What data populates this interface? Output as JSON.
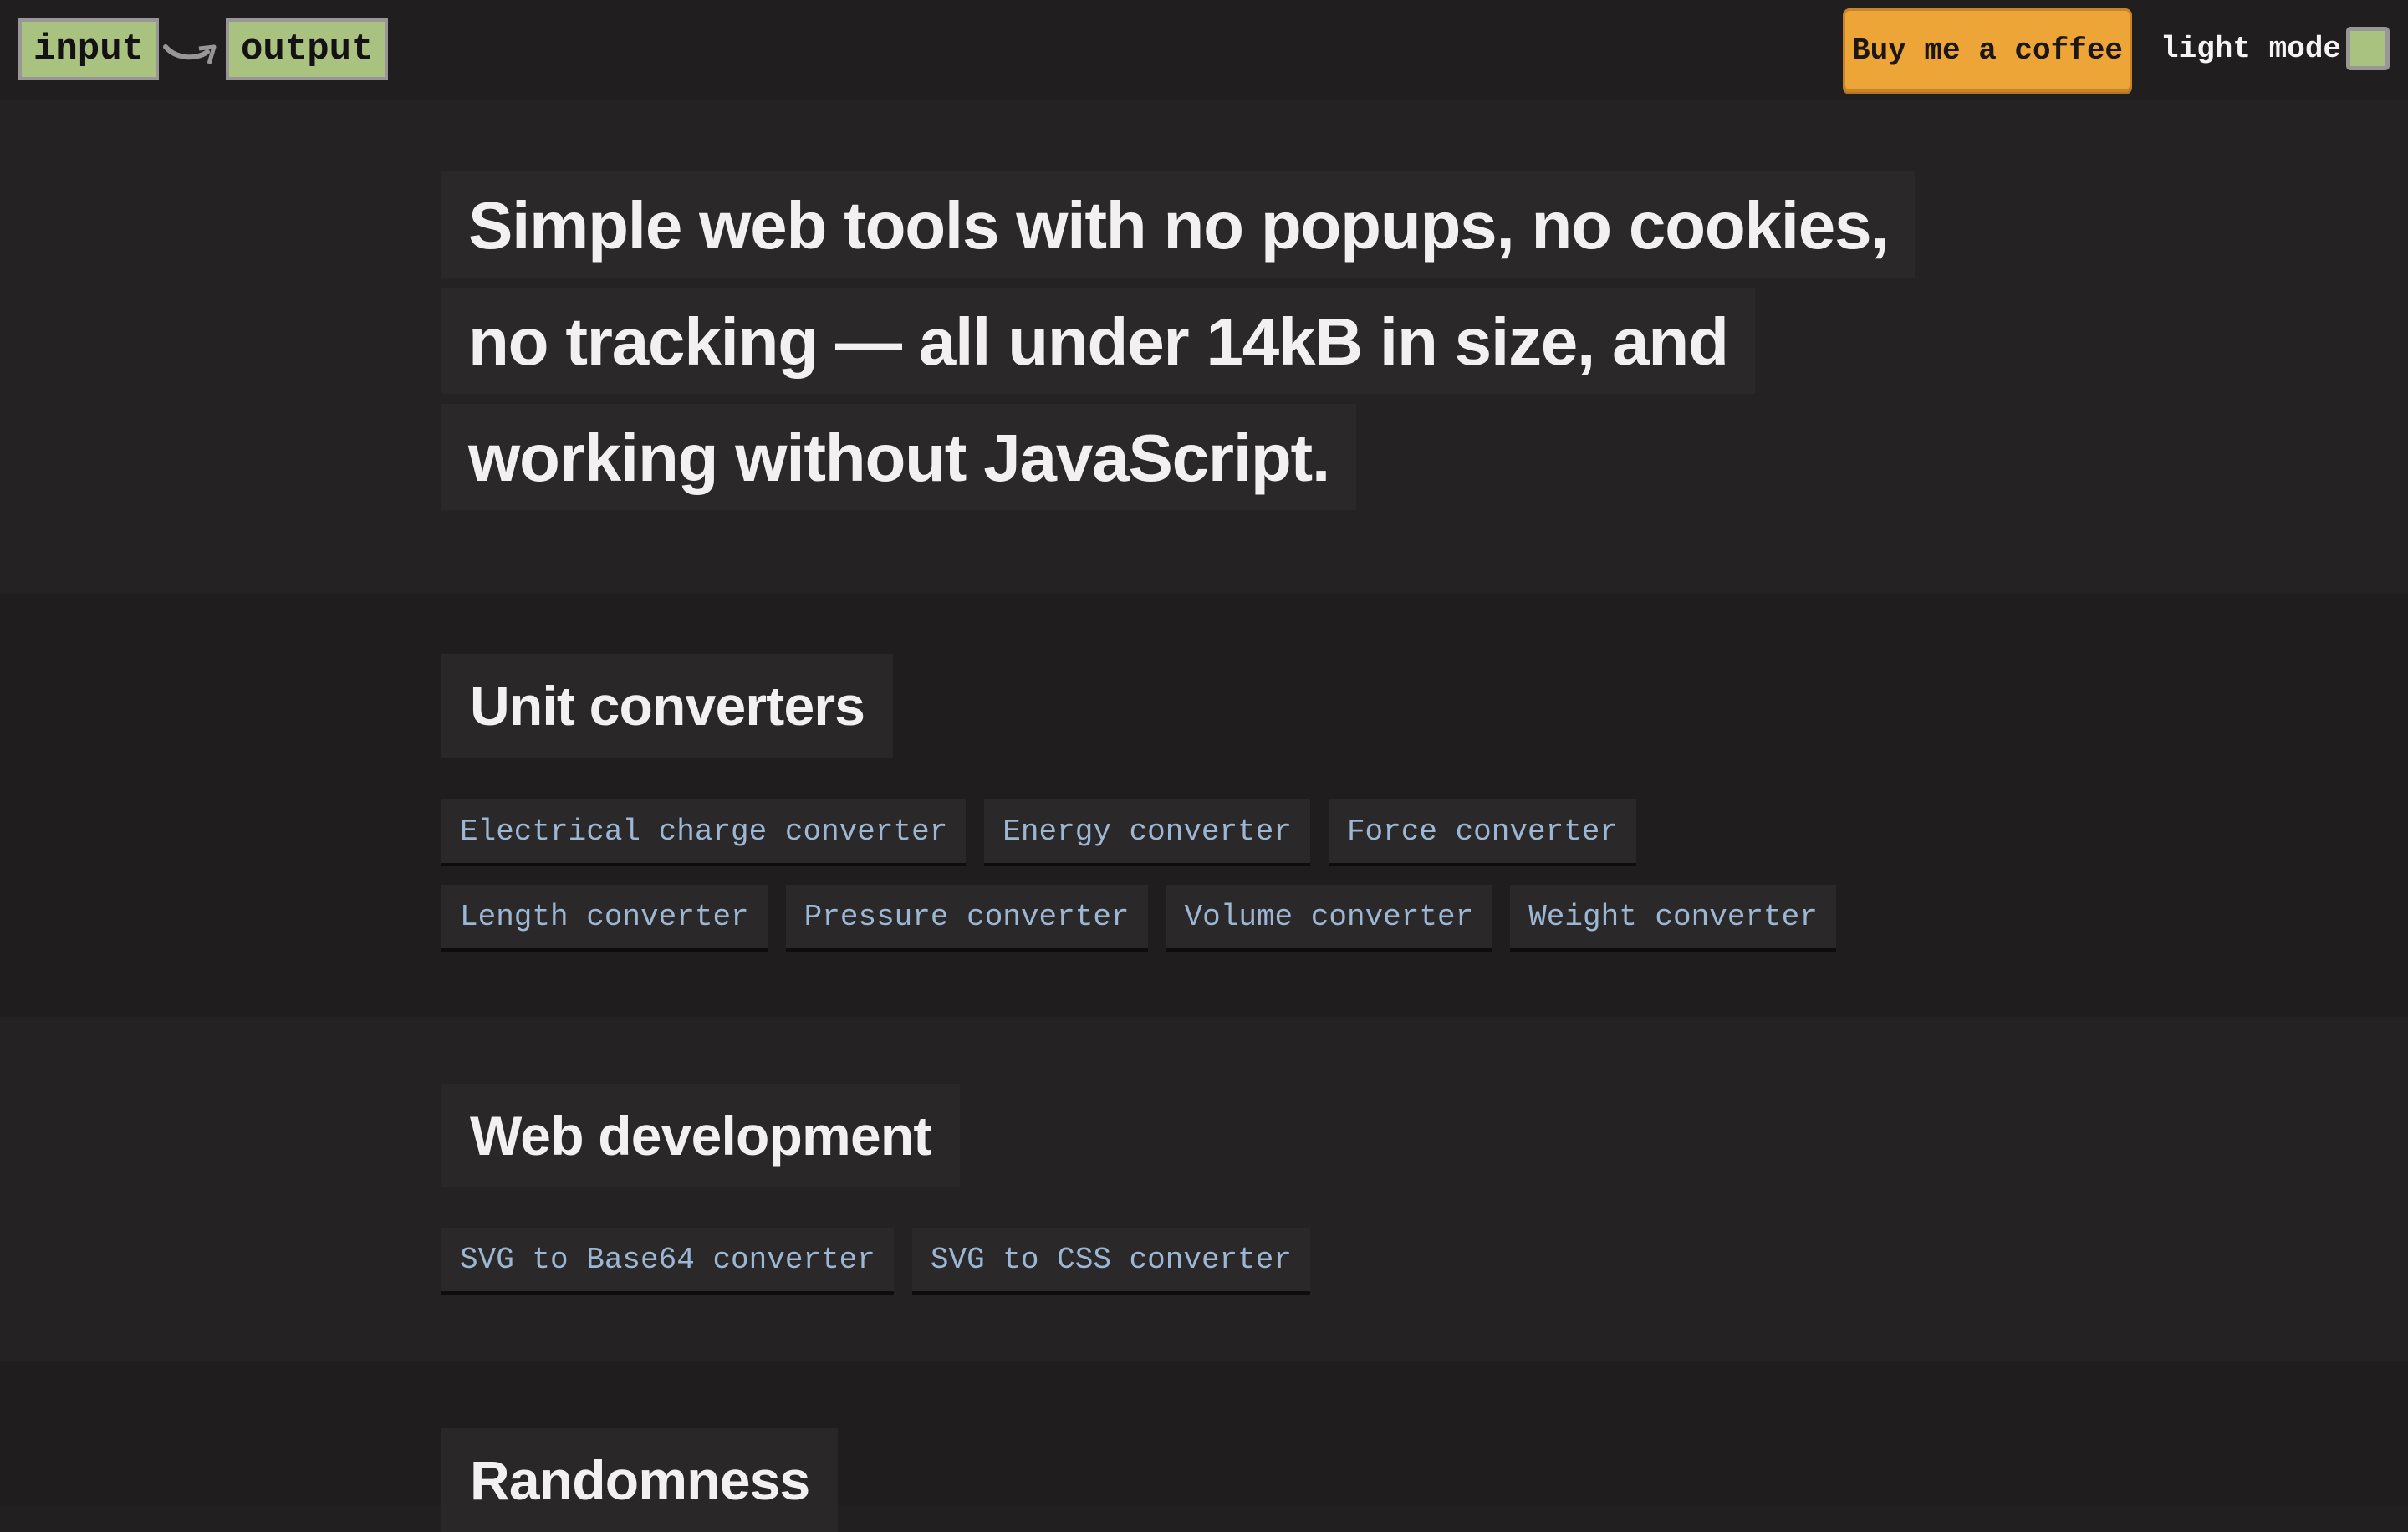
{
  "header": {
    "logo_input": "input",
    "logo_output": "output",
    "coffee_label": "Buy me a coffee",
    "mode_label": "light mode"
  },
  "hero": {
    "title": "Simple web tools with no popups, no cookies, no tracking — all under 14kB in size, and working without JavaScript."
  },
  "sections": [
    {
      "title": "Unit converters",
      "links": [
        "Electrical charge converter",
        "Energy converter",
        "Force converter",
        "Length converter",
        "Pressure converter",
        "Volume converter",
        "Weight converter"
      ]
    },
    {
      "title": "Web development",
      "links": [
        "SVG to Base64 converter",
        "SVG to CSS converter"
      ]
    },
    {
      "title": "Randomness",
      "links": []
    }
  ],
  "colors": {
    "background": "#221f21",
    "logo_green": "#a9c27f",
    "coffee_orange": "#eda538",
    "link_blue": "#9cb7d3"
  },
  "icons": {
    "logo_arrow": "curved-arrow-icon"
  }
}
